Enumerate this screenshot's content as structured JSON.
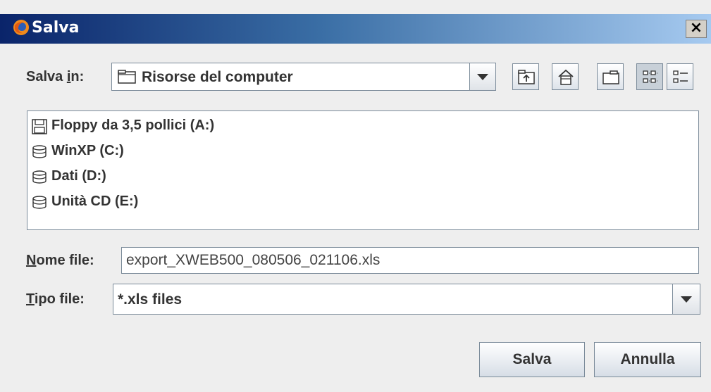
{
  "window": {
    "title": "Salva"
  },
  "save_in": {
    "label_before": "Salva ",
    "label_mnemonic": "i",
    "label_after": "n:",
    "selected": "Risorse del computer"
  },
  "toolbar": {
    "icons": [
      "up-one-level-icon",
      "home-icon",
      "new-folder-icon",
      "list-view-icon",
      "details-view-icon"
    ]
  },
  "file_list": {
    "items": [
      {
        "label": "Floppy da 3,5 pollici (A:)",
        "icon": "floppy-icon"
      },
      {
        "label": "WinXP (C:)",
        "icon": "hard-disk-icon"
      },
      {
        "label": "Dati (D:)",
        "icon": "hard-disk-icon"
      },
      {
        "label": "Unità CD (E:)",
        "icon": "hard-disk-icon"
      }
    ]
  },
  "file_name": {
    "label_mnemonic": "N",
    "label_after": "ome file:",
    "value": "export_XWEB500_080506_021106.xls"
  },
  "file_type": {
    "label_mnemonic": "T",
    "label_after": "ipo file:",
    "selected": "*.xls files"
  },
  "buttons": {
    "save": "Salva",
    "cancel": "Annulla"
  },
  "colors": {
    "title_start": "#0a246a",
    "title_end": "#a6caf0",
    "background": "#eeeeee"
  }
}
